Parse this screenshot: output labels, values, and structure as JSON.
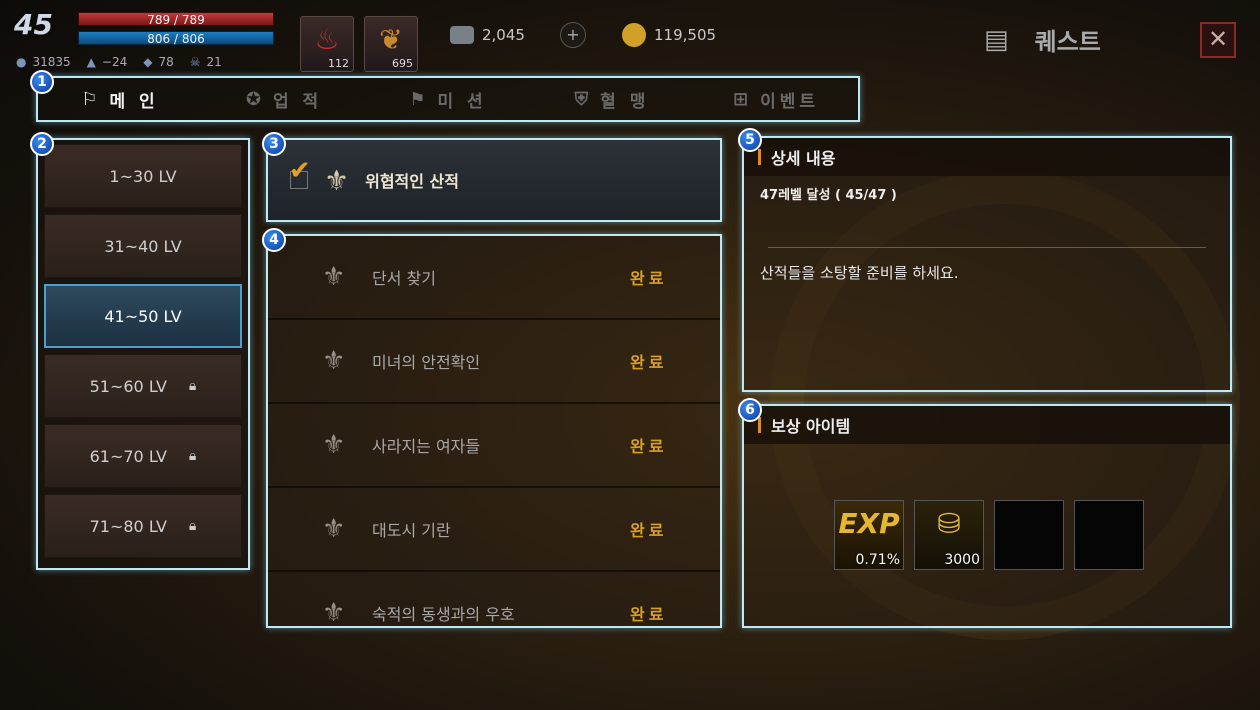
{
  "hud": {
    "level": "45",
    "hp": "789 / 789",
    "mp": "806 / 806",
    "stats": [
      {
        "icon": "water-drop-icon",
        "value": "31835"
      },
      {
        "icon": "helmet-icon",
        "value": "−24"
      },
      {
        "icon": "speed-icon",
        "value": "78"
      },
      {
        "icon": "skull-icon",
        "value": "21"
      }
    ],
    "items": [
      {
        "icon": "potion-icon",
        "count": "112"
      },
      {
        "icon": "feather-icon",
        "count": "695"
      }
    ],
    "gems": "2,045",
    "gold": "119,505",
    "title": "퀘스트"
  },
  "tabs": [
    {
      "label": "메 인",
      "icon": "flag-icon",
      "active": true
    },
    {
      "label": "업 적",
      "icon": "medal-icon",
      "active": false
    },
    {
      "label": "미 션",
      "icon": "banner-icon",
      "active": false
    },
    {
      "label": "혈 맹",
      "icon": "shield-icon",
      "active": false
    },
    {
      "label": "이벤트",
      "icon": "gift-icon",
      "active": false
    }
  ],
  "levels": [
    {
      "label": "1~30 LV",
      "locked": false,
      "active": false
    },
    {
      "label": "31~40 LV",
      "locked": false,
      "active": false
    },
    {
      "label": "41~50 LV",
      "locked": false,
      "active": true
    },
    {
      "label": "51~60 LV",
      "locked": true,
      "active": false
    },
    {
      "label": "61~70 LV",
      "locked": true,
      "active": false
    },
    {
      "label": "71~80 LV",
      "locked": true,
      "active": false
    }
  ],
  "current_quest": {
    "name": "위협적인 산적"
  },
  "quests": [
    {
      "name": "단서 찾기",
      "status": "완료"
    },
    {
      "name": "미녀의 안전확인",
      "status": "완료"
    },
    {
      "name": "사라지는 여자들",
      "status": "완료"
    },
    {
      "name": "대도시 기란",
      "status": "완료"
    },
    {
      "name": "숙적의 동생과의 우호",
      "status": "완료"
    }
  ],
  "detail": {
    "heading": "상세 내용",
    "goal": "47레벨 달성 ( 45/47 )",
    "description": "산적들을 소탕할 준비를 하세요."
  },
  "rewards": {
    "heading": "보상 아이템",
    "items": [
      {
        "type": "exp",
        "label": "EXP",
        "amount": "0.71%"
      },
      {
        "type": "gold",
        "label": "",
        "amount": "3000"
      },
      {
        "type": "empty",
        "label": "",
        "amount": ""
      },
      {
        "type": "empty",
        "label": "",
        "amount": ""
      }
    ]
  },
  "badges": [
    "1",
    "2",
    "3",
    "4",
    "5",
    "6"
  ],
  "colors": {
    "outline": "#bfe8f5",
    "complete": "#d9a028",
    "badge": "#1a5fd0"
  }
}
